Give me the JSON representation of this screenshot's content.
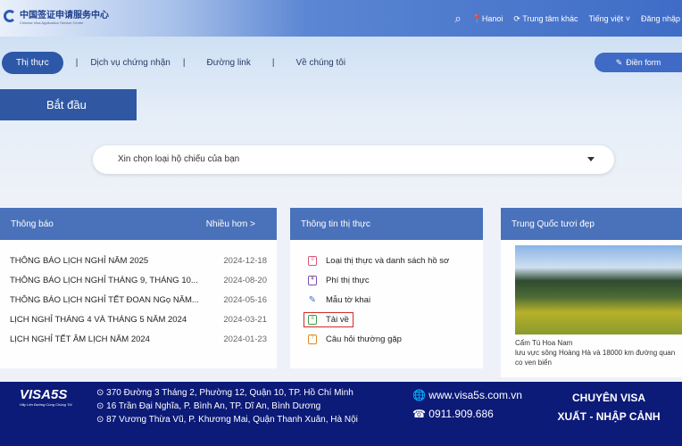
{
  "header": {
    "logo_cn": "中国签证申请服务中心",
    "logo_en": "Chinese Visa Application Service Center",
    "location": "Hanoi",
    "other_center": "Trung tâm khác",
    "language": "Tiếng việt",
    "login": "Đăng nhập"
  },
  "nav": {
    "items": [
      "Thị thực",
      "Dịch vụ chứng nhận",
      "Đường link",
      "Về chúng tôi"
    ],
    "fill_form": "Điền form"
  },
  "start": "Bắt đầu",
  "passport_select": {
    "placeholder": "Xin chọn loại hộ chiếu của bạn"
  },
  "notices": {
    "title": "Thông báo",
    "more": "Nhiều hơn >",
    "items": [
      {
        "title": "THÔNG BÁO LỊCH NGHỈ NĂM 2025",
        "date": "2024-12-18"
      },
      {
        "title": "THÔNG BÁO LỊCH NGHỈ THÁNG 9, THÁNG 10...",
        "date": "2024-08-20"
      },
      {
        "title": "THÔNG BÁO LỊCH NGHỈ TẾT ĐOAN NGọ NĂM...",
        "date": "2024-05-16"
      },
      {
        "title": "LỊCH NGHỈ THÁNG 4 VÀ THÁNG 5 NĂM 2024",
        "date": "2024-03-21"
      },
      {
        "title": "LỊCH NGHỈ TẾT ÂM LỊCH NĂM 2024",
        "date": "2024-01-23"
      }
    ]
  },
  "visa_info": {
    "title": "Thông tin thị thực",
    "items": [
      {
        "label": "Loại thị thực và danh sách hồ sơ",
        "icon": "list-icon",
        "color": "#d9587a"
      },
      {
        "label": "Phí thị thực",
        "icon": "fee-icon",
        "color": "#7a4fb0"
      },
      {
        "label": "Mẫu tờ khai",
        "icon": "form-icon",
        "color": "#3a72c8"
      },
      {
        "label": "Tải về",
        "icon": "download-icon",
        "color": "#3aa04a"
      },
      {
        "label": "Câu hỏi thường gặp",
        "icon": "faq-icon",
        "color": "#e08a1e"
      }
    ]
  },
  "beautiful_china": {
    "title": "Trung Quốc tươi đẹp",
    "caption": "Cẩm Tú Hoa Nam",
    "description": "lưu vực sông Hoàng Hà và 18000 km đường quan",
    "description2": "co ven biển"
  },
  "footer": {
    "brand": "VISA5S",
    "tagline": "Hãy Lên Đường Cùng Chúng Tôi",
    "addresses": [
      "370 Đường 3 Tháng 2, Phường 12, Quận 10, TP. Hồ Chí Minh",
      "16 Trần Đại Nghĩa, P. Bình An, TP. Dĩ An, Bình Dương",
      "87 Vương Thừa Vũ, P. Khương Mai, Quận Thanh Xuân, Hà Nội"
    ],
    "website": "www.visa5s.com.vn",
    "phone": "0911.909.686",
    "slogan1": "CHUYÊN VISA",
    "slogan2": "XUẤT - NHẬP CẢNH"
  },
  "colors": {
    "primary": "#2f57a2",
    "panel_header": "#4a72bb",
    "footer": "#0c1a78",
    "highlight": "#d02a2a"
  }
}
